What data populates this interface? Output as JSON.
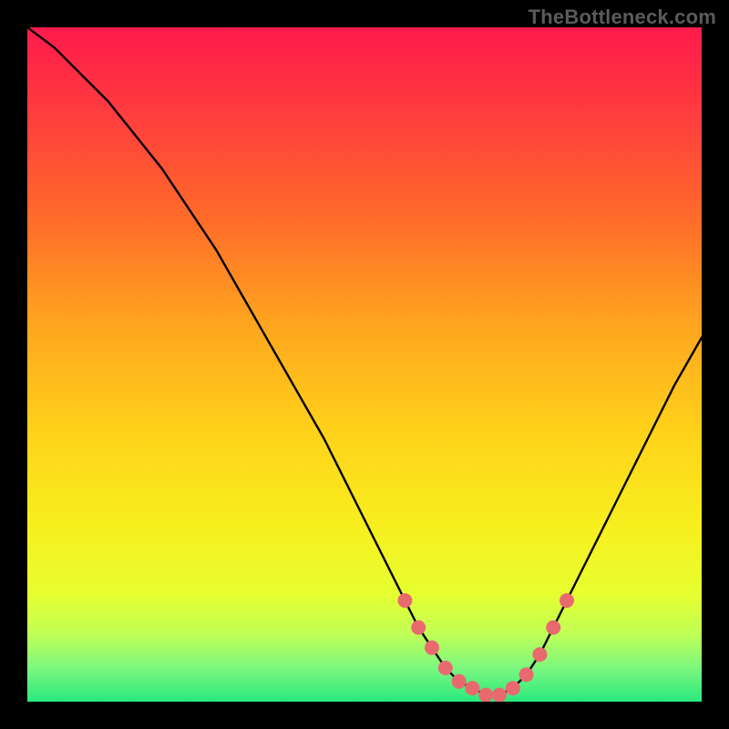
{
  "watermark": "TheBottleneck.com",
  "gradient": {
    "stops": [
      {
        "offset": 0.0,
        "color": "#ff1a4b"
      },
      {
        "offset": 0.12,
        "color": "#ff3a3f"
      },
      {
        "offset": 0.28,
        "color": "#ff6a2a"
      },
      {
        "offset": 0.44,
        "color": "#ffa51f"
      },
      {
        "offset": 0.6,
        "color": "#ffd21a"
      },
      {
        "offset": 0.74,
        "color": "#f7ef1e"
      },
      {
        "offset": 0.84,
        "color": "#e7ff30"
      },
      {
        "offset": 0.9,
        "color": "#c0ff55"
      },
      {
        "offset": 0.95,
        "color": "#7cf77f"
      },
      {
        "offset": 1.0,
        "color": "#29e97e"
      }
    ]
  },
  "chart_data": {
    "type": "line",
    "title": "",
    "xlabel": "",
    "ylabel": "",
    "xlim": [
      0,
      100
    ],
    "ylim": [
      0,
      100
    ],
    "x": [
      0,
      4,
      8,
      12,
      16,
      20,
      24,
      28,
      32,
      36,
      40,
      44,
      48,
      52,
      56,
      58,
      60,
      62,
      64,
      66,
      68,
      70,
      72,
      74,
      76,
      78,
      80,
      84,
      88,
      92,
      96,
      100
    ],
    "values": [
      100,
      97,
      93,
      89,
      84,
      79,
      73,
      67,
      60,
      53,
      46,
      39,
      31,
      23,
      15,
      11,
      8,
      5,
      3,
      2,
      1,
      1,
      2,
      4,
      7,
      11,
      15,
      23,
      31,
      39,
      47,
      54
    ],
    "markers": {
      "color": "#e86a6f",
      "radius": 8,
      "points": [
        {
          "x": 56,
          "y": 15
        },
        {
          "x": 58,
          "y": 11
        },
        {
          "x": 60,
          "y": 8
        },
        {
          "x": 62,
          "y": 5
        },
        {
          "x": 64,
          "y": 3
        },
        {
          "x": 66,
          "y": 2
        },
        {
          "x": 68,
          "y": 1
        },
        {
          "x": 70,
          "y": 1
        },
        {
          "x": 72,
          "y": 2
        },
        {
          "x": 74,
          "y": 4
        },
        {
          "x": 76,
          "y": 7
        },
        {
          "x": 78,
          "y": 11
        },
        {
          "x": 80,
          "y": 15
        }
      ]
    }
  }
}
